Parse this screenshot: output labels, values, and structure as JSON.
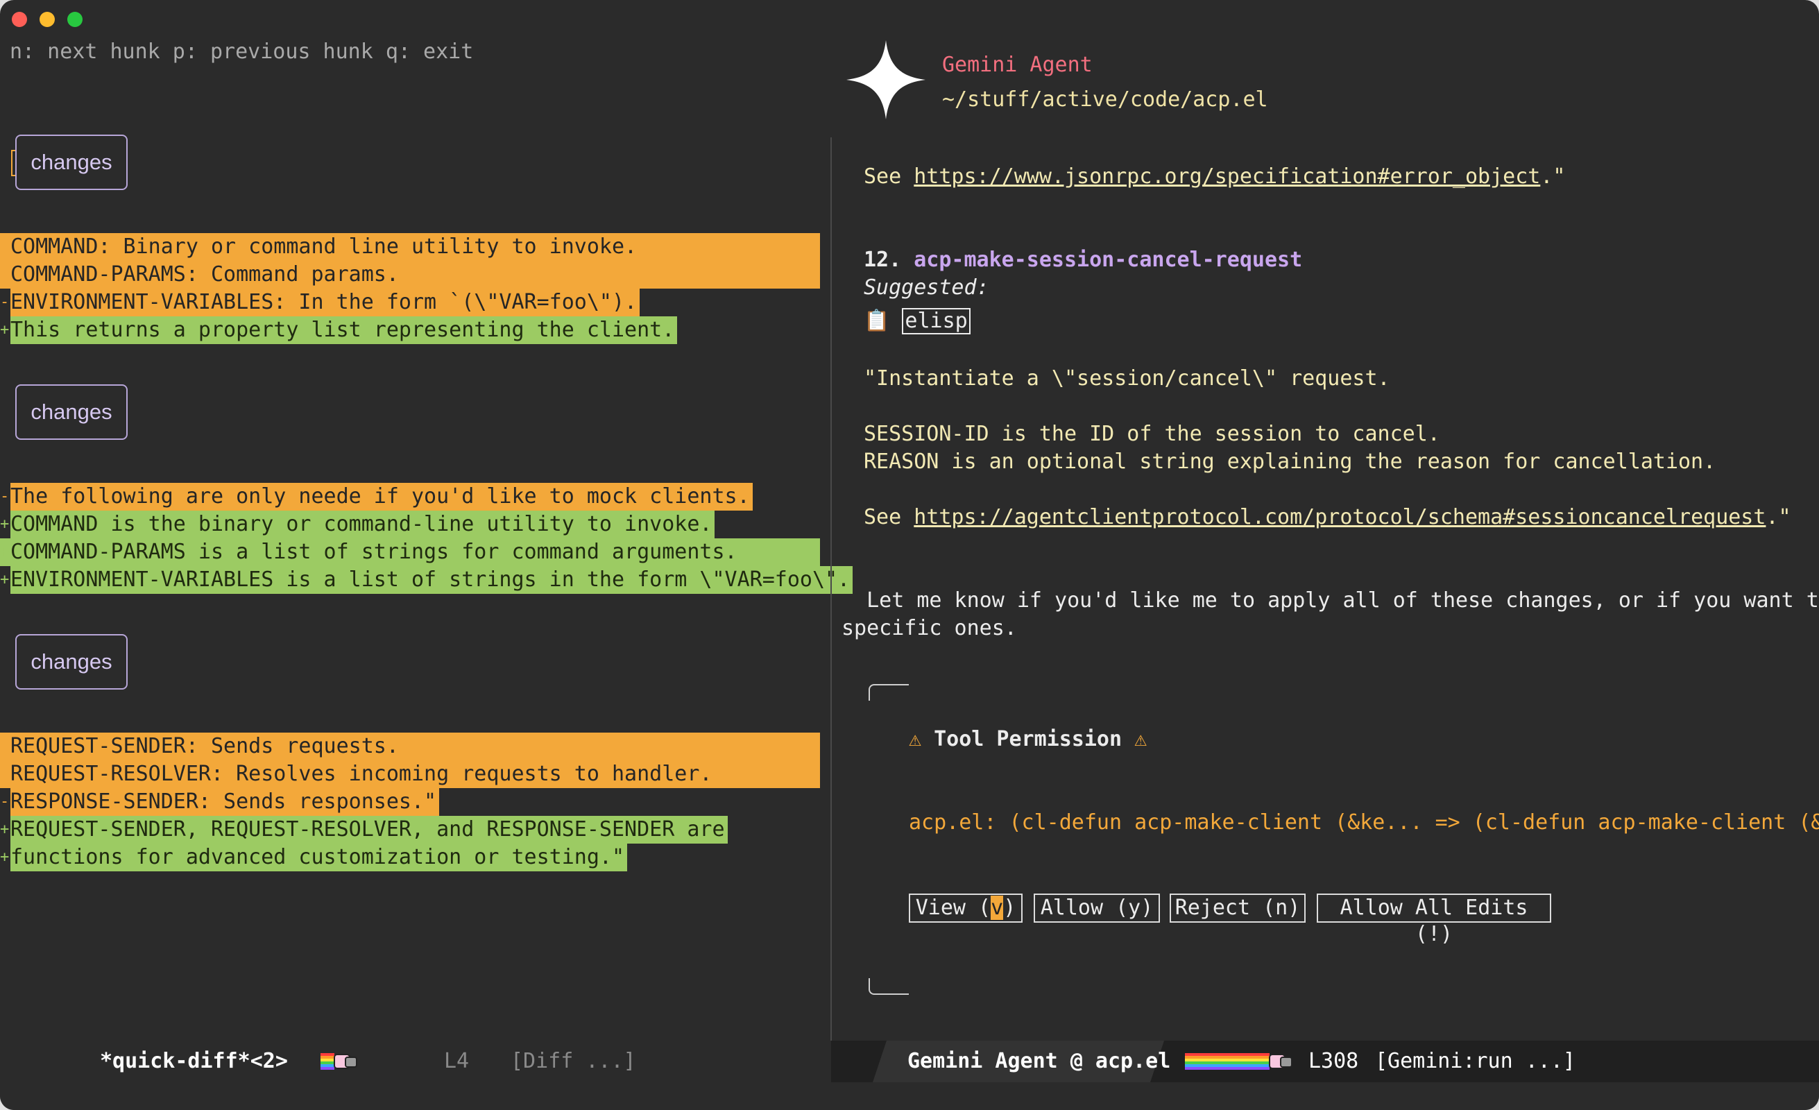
{
  "window": {
    "colors": {
      "bg": "#2b2b2b",
      "deleted": "#f3a83a",
      "added": "#9ccb63",
      "accent_pink": "#f36f7f",
      "fn_purple": "#c9a6ee"
    }
  },
  "diff": {
    "help": "n: next hunk p: previous hunk q: exit",
    "hunk_label": "changes",
    "hunk1": [
      {
        "kind": "-",
        "text": "COMMAND: Binary or command line utility to invoke."
      },
      {
        "kind": "-",
        "text": "COMMAND-PARAMS: Command params."
      },
      {
        "kind": "-",
        "text": "ENVIRONMENT-VARIABLES: In the form `(\\\"VAR=foo\\\")."
      },
      {
        "kind": "+",
        "text": "This returns a property list representing the client."
      }
    ],
    "hunk2": [
      {
        "kind": "-",
        "text": "The following are only neede if you'd like to mock clients."
      },
      {
        "kind": "+",
        "text": "COMMAND is the binary or command-line utility to invoke."
      },
      {
        "kind": "+",
        "text": "COMMAND-PARAMS is a list of strings for command arguments."
      },
      {
        "kind": "+",
        "text": "ENVIRONMENT-VARIABLES is a list of strings in the form \\\"VAR=foo\\\"."
      }
    ],
    "hunk3": [
      {
        "kind": "-",
        "text": "REQUEST-SENDER: Sends requests."
      },
      {
        "kind": "-",
        "text": "REQUEST-RESOLVER: Resolves incoming requests to handler."
      },
      {
        "kind": "-",
        "text": "RESPONSE-SENDER: Sends responses.\""
      },
      {
        "kind": "+",
        "text": "REQUEST-SENDER, REQUEST-RESOLVER, and RESPONSE-SENDER are"
      },
      {
        "kind": "+",
        "text": "functions for advanced customization or testing.\""
      }
    ]
  },
  "agent": {
    "name": "Gemini Agent",
    "path": "~/stuff/active/code/acp.el",
    "see1_prefix": "See ",
    "see1_link": "https://www.jsonrpc.org/specification#error_object",
    "see1_suffix": ".\"",
    "item_num": "12. ",
    "item_name": "acp-make-session-cancel-request",
    "suggested": "Suggested:",
    "clipboard_icon": "📋",
    "elisp": "elisp",
    "doc1": "\"Instantiate a \\\"session/cancel\\\" request.",
    "doc2": "SESSION-ID is the ID of the session to cancel.",
    "doc3": "REASON is an optional string explaining the reason for cancellation.",
    "see2_prefix": "See ",
    "see2_link": "https://agentclientprotocol.com/protocol/schema#sessioncancelrequest",
    "see2_suffix": ".\"",
    "let_me_know1": "  Let me know if you'd like me to apply all of these changes, or if you want to select",
    "let_me_know2": "specific ones.",
    "perm_warn": "⚠",
    "perm_title": "Tool Permission",
    "perm_desc": "acp.el: (cl-defun acp-make-client (&ke... => (cl-defun acp-make-client (&ke...",
    "buttons": {
      "view_prefix": "View (",
      "view_key": "v",
      "view_suffix": ")",
      "allow": "Allow (y)",
      "reject": "Reject (n)",
      "allow_all": "Allow All Edits (!)"
    }
  },
  "modeline": {
    "left_buffer": "*quick-diff*<2>",
    "left_line": "L4",
    "left_mode": "[Diff ...]",
    "right_buffer": "Gemini Agent @ acp.el",
    "right_line": "L308",
    "right_mode": "[Gemini:run ...]"
  }
}
